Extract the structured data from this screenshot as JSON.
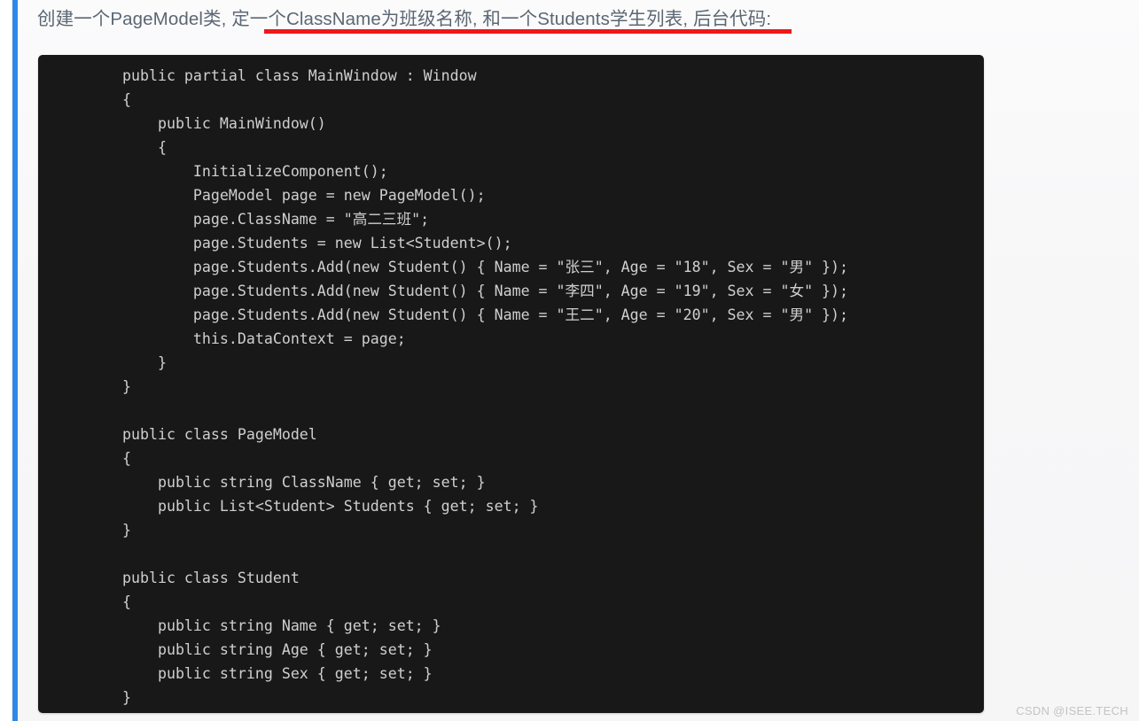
{
  "page": {
    "background_color": "#f7f7f8",
    "accent_rail_color": "#2f88e8"
  },
  "intro": {
    "before_underline": "创建一个PageModel类, ",
    "underlined": "定一个ClassName为班级名称, 和一个Students学生列表",
    "after_underline": ", 后台代码:",
    "full_text": "创建一个PageModel类, 定一个ClassName为班级名称, 和一个Students学生列表, 后台代码:",
    "text_color": "#5c6773",
    "underline_color": "#ef1717"
  },
  "code_block": {
    "language": "csharp",
    "background_color": "#181818",
    "text_color": "#cfcfcf",
    "content": "public partial class MainWindow : Window\n{\n    public MainWindow()\n    {\n        InitializeComponent();\n        PageModel page = new PageModel();\n        page.ClassName = \"高二三班\";\n        page.Students = new List<Student>();\n        page.Students.Add(new Student() { Name = \"张三\", Age = \"18\", Sex = \"男\" });\n        page.Students.Add(new Student() { Name = \"李四\", Age = \"19\", Sex = \"女\" });\n        page.Students.Add(new Student() { Name = \"王二\", Age = \"20\", Sex = \"男\" });\n        this.DataContext = page;\n    }\n}\n\npublic class PageModel\n{\n    public string ClassName { get; set; }\n    public List<Student> Students { get; set; }\n}\n\npublic class Student\n{\n    public string Name { get; set; }\n    public string Age { get; set; }\n    public string Sex { get; set; }\n}",
    "students": [
      {
        "name": "张三",
        "age": "18",
        "sex": "男"
      },
      {
        "name": "李四",
        "age": "19",
        "sex": "女"
      },
      {
        "name": "王二",
        "age": "20",
        "sex": "男"
      }
    ],
    "class_name_value": "高二三班"
  },
  "watermark": {
    "text": "CSDN @ISEE.TECH",
    "color": "#c3c3c6"
  }
}
